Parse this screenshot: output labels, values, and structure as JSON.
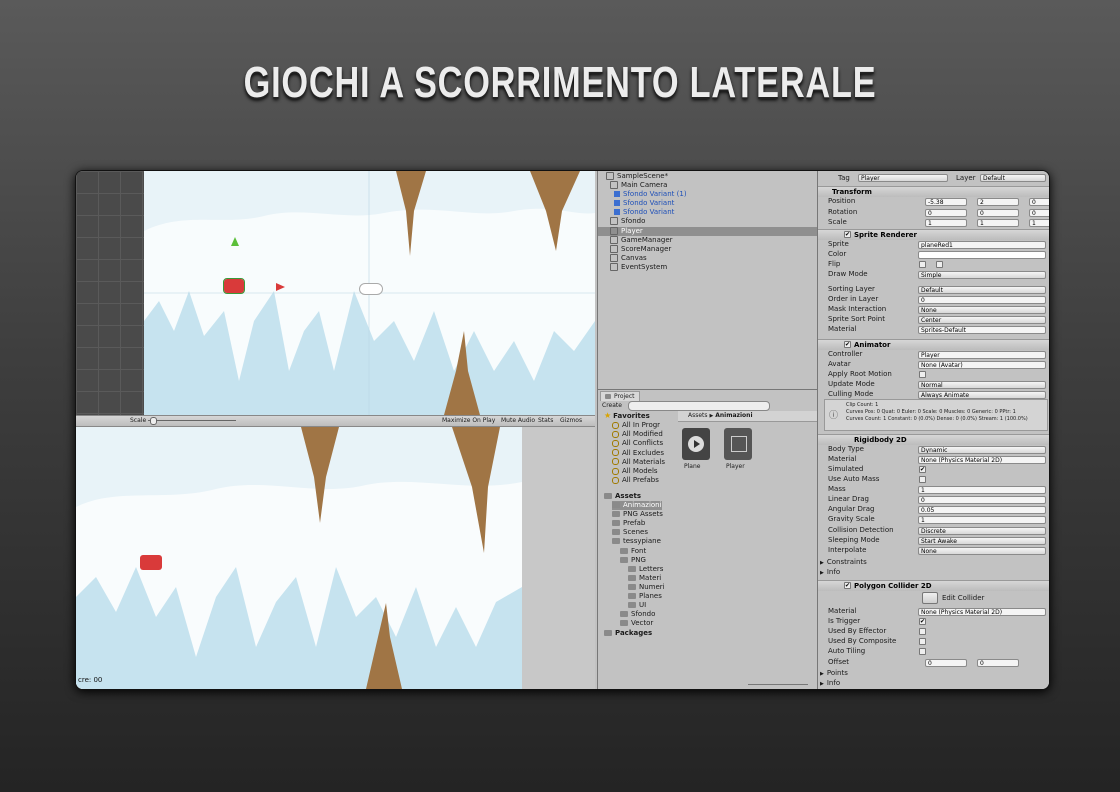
{
  "title": "GIOCHI A SCORRIMENTO LATERALE",
  "game_toolbar": {
    "scale_label": "Scale",
    "maximize": "Maximize On Play",
    "mute": "Mute Audio",
    "stats": "Stats",
    "gizmos": "Gizmos",
    "score": "cre:  00"
  },
  "hierarchy": {
    "scene": "SampleScene*",
    "items": [
      "Main Camera",
      "Sfondo Variant (1)",
      "Sfondo Variant",
      "Sfondo Variant",
      "Sfondo",
      "Player",
      "GameManager",
      "ScoreManager",
      "Canvas",
      "EventSystem"
    ]
  },
  "project": {
    "tab": "Project",
    "create": "Create",
    "favorites_label": "Favorites",
    "favorites": [
      "All In Progr",
      "All Modified",
      "All Conflicts",
      "All Excludes",
      "All Materials",
      "All Models",
      "All Prefabs"
    ],
    "assets_label": "Assets",
    "breadcrumb_assets": "Assets",
    "breadcrumb_sep": "▶",
    "breadcrumb_current": "Animazioni",
    "tree": [
      "Animazioni",
      "PNG Assets",
      "Prefab",
      "Scenes",
      "tessypiane",
      "Font",
      "PNG",
      "Letters",
      "Materi",
      "Numeri",
      "Planes",
      "UI",
      "Sfondo",
      "Vector"
    ],
    "packages": "Packages",
    "tiles": [
      "Plane",
      "Player"
    ]
  },
  "inspector": {
    "tag_label": "Tag",
    "tag_value": "Player",
    "layer_label": "Layer",
    "layer_value": "Default",
    "transform": {
      "header": "Transform",
      "position_label": "Position",
      "rotation_label": "Rotation",
      "scale_label": "Scale",
      "x": "X",
      "y": "Y",
      "z": "Z",
      "pos": [
        "-5.38",
        "2",
        "0"
      ],
      "rot": [
        "0",
        "0",
        "0"
      ],
      "scl": [
        "1",
        "1",
        "1"
      ]
    },
    "sprite_renderer": {
      "header": "Sprite Renderer",
      "sprite_label": "Sprite",
      "sprite_value": "planeRed1",
      "color_label": "Color",
      "flip_label": "Flip",
      "flip_x": "X",
      "flip_y": "Y",
      "draw_mode_label": "Draw Mode",
      "draw_mode_value": "Simple",
      "sorting_layer_label": "Sorting Layer",
      "sorting_layer_value": "Default",
      "order_label": "Order in Layer",
      "order_value": "0",
      "mask_label": "Mask Interaction",
      "mask_value": "None",
      "sort_point_label": "Sprite Sort Point",
      "sort_point_value": "Center",
      "material_label": "Material",
      "material_value": "Sprites-Default"
    },
    "animator": {
      "header": "Animator",
      "controller_label": "Controller",
      "controller_value": "Player",
      "avatar_label": "Avatar",
      "avatar_value": "None (Avatar)",
      "root_motion_label": "Apply Root Motion",
      "update_label": "Update Mode",
      "update_value": "Normal",
      "culling_label": "Culling Mode",
      "culling_value": "Always Animate",
      "info1": "Clip Count: 1",
      "info2": "Curves Pos: 0 Quat: 0 Euler: 0 Scale: 0 Muscles: 0 Generic: 0 PPtr: 1",
      "info3": "Curves Count: 1 Constant: 0 (0.0%) Dense: 0 (0.0%) Stream: 1 (100.0%)"
    },
    "rigidbody": {
      "header": "Rigidbody 2D",
      "body_type_label": "Body Type",
      "body_type_value": "Dynamic",
      "material_label": "Material",
      "material_value": "None (Physics Material 2D)",
      "simulated_label": "Simulated",
      "auto_mass_label": "Use Auto Mass",
      "mass_label": "Mass",
      "mass_value": "1",
      "linear_drag_label": "Linear Drag",
      "linear_drag_value": "0",
      "angular_drag_label": "Angular Drag",
      "angular_drag_value": "0.05",
      "gravity_label": "Gravity Scale",
      "gravity_value": "1",
      "collision_label": "Collision Detection",
      "collision_value": "Discrete",
      "sleeping_label": "Sleeping Mode",
      "sleeping_value": "Start Awake",
      "interpolate_label": "Interpolate",
      "interpolate_value": "None",
      "constraints_label": "Constraints",
      "info_label": "Info"
    },
    "collider": {
      "header": "Polygon Collider 2D",
      "edit_label": "Edit Collider",
      "material_label": "Material",
      "material_value": "None (Physics Material 2D)",
      "trigger_label": "Is Trigger",
      "effector_label": "Used By Effector",
      "composite_label": "Used By Composite",
      "autotiling_label": "Auto Tiling",
      "offset_label": "Offset",
      "offset_x": "0",
      "offset_y": "0",
      "points_label": "Points",
      "info_label": "Info"
    }
  },
  "colors": {
    "sky": "#e8f3f8",
    "cloud": "#ffffff",
    "mountain": "#c6e3ef",
    "rock": "#a07545",
    "rock_dark": "#7a5530",
    "plane": "#d93a3a",
    "panel": "#c2c2c2"
  }
}
